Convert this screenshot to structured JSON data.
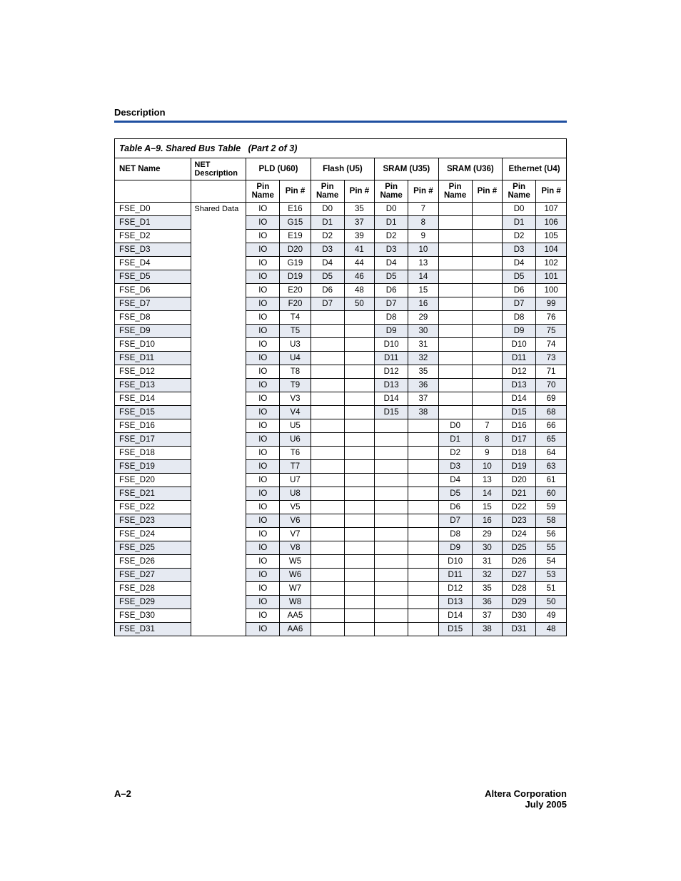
{
  "header": "Description",
  "caption": "Table A–9. Shared Bus Table   (Part 2 of 3)",
  "cols": {
    "net_name": "NET Name",
    "net_desc": "NET Description",
    "groups": [
      "PLD (U60)",
      "Flash (U5)",
      "SRAM (U35)",
      "SRAM (U36)",
      "Ethernet (U4)"
    ],
    "pin_name": "Pin Name",
    "pin_num": "Pin #",
    "pin_num_short": "Pin #"
  },
  "shared_desc": "Shared Data",
  "rows": [
    {
      "n": "FSE_D0",
      "pld": [
        "IO",
        "E16"
      ],
      "flash": [
        "D0",
        "35"
      ],
      "s35": [
        "D0",
        "7"
      ],
      "s36": [
        "",
        ""
      ],
      "eth": [
        "D0",
        "107"
      ]
    },
    {
      "n": "FSE_D1",
      "pld": [
        "IO",
        "G15"
      ],
      "flash": [
        "D1",
        "37"
      ],
      "s35": [
        "D1",
        "8"
      ],
      "s36": [
        "",
        ""
      ],
      "eth": [
        "D1",
        "106"
      ]
    },
    {
      "n": "FSE_D2",
      "pld": [
        "IO",
        "E19"
      ],
      "flash": [
        "D2",
        "39"
      ],
      "s35": [
        "D2",
        "9"
      ],
      "s36": [
        "",
        ""
      ],
      "eth": [
        "D2",
        "105"
      ]
    },
    {
      "n": "FSE_D3",
      "pld": [
        "IO",
        "D20"
      ],
      "flash": [
        "D3",
        "41"
      ],
      "s35": [
        "D3",
        "10"
      ],
      "s36": [
        "",
        ""
      ],
      "eth": [
        "D3",
        "104"
      ]
    },
    {
      "n": "FSE_D4",
      "pld": [
        "IO",
        "G19"
      ],
      "flash": [
        "D4",
        "44"
      ],
      "s35": [
        "D4",
        "13"
      ],
      "s36": [
        "",
        ""
      ],
      "eth": [
        "D4",
        "102"
      ]
    },
    {
      "n": "FSE_D5",
      "pld": [
        "IO",
        "D19"
      ],
      "flash": [
        "D5",
        "46"
      ],
      "s35": [
        "D5",
        "14"
      ],
      "s36": [
        "",
        ""
      ],
      "eth": [
        "D5",
        "101"
      ]
    },
    {
      "n": "FSE_D6",
      "pld": [
        "IO",
        "E20"
      ],
      "flash": [
        "D6",
        "48"
      ],
      "s35": [
        "D6",
        "15"
      ],
      "s36": [
        "",
        ""
      ],
      "eth": [
        "D6",
        "100"
      ]
    },
    {
      "n": "FSE_D7",
      "pld": [
        "IO",
        "F20"
      ],
      "flash": [
        "D7",
        "50"
      ],
      "s35": [
        "D7",
        "16"
      ],
      "s36": [
        "",
        ""
      ],
      "eth": [
        "D7",
        "99"
      ]
    },
    {
      "n": "FSE_D8",
      "pld": [
        "IO",
        "T4"
      ],
      "flash": [
        "",
        ""
      ],
      "s35": [
        "D8",
        "29"
      ],
      "s36": [
        "",
        ""
      ],
      "eth": [
        "D8",
        "76"
      ]
    },
    {
      "n": "FSE_D9",
      "pld": [
        "IO",
        "T5"
      ],
      "flash": [
        "",
        ""
      ],
      "s35": [
        "D9",
        "30"
      ],
      "s36": [
        "",
        ""
      ],
      "eth": [
        "D9",
        "75"
      ]
    },
    {
      "n": "FSE_D10",
      "pld": [
        "IO",
        "U3"
      ],
      "flash": [
        "",
        ""
      ],
      "s35": [
        "D10",
        "31"
      ],
      "s36": [
        "",
        ""
      ],
      "eth": [
        "D10",
        "74"
      ]
    },
    {
      "n": "FSE_D11",
      "pld": [
        "IO",
        "U4"
      ],
      "flash": [
        "",
        ""
      ],
      "s35": [
        "D11",
        "32"
      ],
      "s36": [
        "",
        ""
      ],
      "eth": [
        "D11",
        "73"
      ]
    },
    {
      "n": "FSE_D12",
      "pld": [
        "IO",
        "T8"
      ],
      "flash": [
        "",
        ""
      ],
      "s35": [
        "D12",
        "35"
      ],
      "s36": [
        "",
        ""
      ],
      "eth": [
        "D12",
        "71"
      ]
    },
    {
      "n": "FSE_D13",
      "pld": [
        "IO",
        "T9"
      ],
      "flash": [
        "",
        ""
      ],
      "s35": [
        "D13",
        "36"
      ],
      "s36": [
        "",
        ""
      ],
      "eth": [
        "D13",
        "70"
      ]
    },
    {
      "n": "FSE_D14",
      "pld": [
        "IO",
        "V3"
      ],
      "flash": [
        "",
        ""
      ],
      "s35": [
        "D14",
        "37"
      ],
      "s36": [
        "",
        ""
      ],
      "eth": [
        "D14",
        "69"
      ]
    },
    {
      "n": "FSE_D15",
      "pld": [
        "IO",
        "V4"
      ],
      "flash": [
        "",
        ""
      ],
      "s35": [
        "D15",
        "38"
      ],
      "s36": [
        "",
        ""
      ],
      "eth": [
        "D15",
        "68"
      ]
    },
    {
      "n": "FSE_D16",
      "pld": [
        "IO",
        "U5"
      ],
      "flash": [
        "",
        ""
      ],
      "s35": [
        "",
        ""
      ],
      "s36": [
        "D0",
        "7"
      ],
      "eth": [
        "D16",
        "66"
      ]
    },
    {
      "n": "FSE_D17",
      "pld": [
        "IO",
        "U6"
      ],
      "flash": [
        "",
        ""
      ],
      "s35": [
        "",
        ""
      ],
      "s36": [
        "D1",
        "8"
      ],
      "eth": [
        "D17",
        "65"
      ]
    },
    {
      "n": "FSE_D18",
      "pld": [
        "IO",
        "T6"
      ],
      "flash": [
        "",
        ""
      ],
      "s35": [
        "",
        ""
      ],
      "s36": [
        "D2",
        "9"
      ],
      "eth": [
        "D18",
        "64"
      ]
    },
    {
      "n": "FSE_D19",
      "pld": [
        "IO",
        "T7"
      ],
      "flash": [
        "",
        ""
      ],
      "s35": [
        "",
        ""
      ],
      "s36": [
        "D3",
        "10"
      ],
      "eth": [
        "D19",
        "63"
      ]
    },
    {
      "n": "FSE_D20",
      "pld": [
        "IO",
        "U7"
      ],
      "flash": [
        "",
        ""
      ],
      "s35": [
        "",
        ""
      ],
      "s36": [
        "D4",
        "13"
      ],
      "eth": [
        "D20",
        "61"
      ]
    },
    {
      "n": "FSE_D21",
      "pld": [
        "IO",
        "U8"
      ],
      "flash": [
        "",
        ""
      ],
      "s35": [
        "",
        ""
      ],
      "s36": [
        "D5",
        "14"
      ],
      "eth": [
        "D21",
        "60"
      ]
    },
    {
      "n": "FSE_D22",
      "pld": [
        "IO",
        "V5"
      ],
      "flash": [
        "",
        ""
      ],
      "s35": [
        "",
        ""
      ],
      "s36": [
        "D6",
        "15"
      ],
      "eth": [
        "D22",
        "59"
      ]
    },
    {
      "n": "FSE_D23",
      "pld": [
        "IO",
        "V6"
      ],
      "flash": [
        "",
        ""
      ],
      "s35": [
        "",
        ""
      ],
      "s36": [
        "D7",
        "16"
      ],
      "eth": [
        "D23",
        "58"
      ]
    },
    {
      "n": "FSE_D24",
      "pld": [
        "IO",
        "V7"
      ],
      "flash": [
        "",
        ""
      ],
      "s35": [
        "",
        ""
      ],
      "s36": [
        "D8",
        "29"
      ],
      "eth": [
        "D24",
        "56"
      ]
    },
    {
      "n": "FSE_D25",
      "pld": [
        "IO",
        "V8"
      ],
      "flash": [
        "",
        ""
      ],
      "s35": [
        "",
        ""
      ],
      "s36": [
        "D9",
        "30"
      ],
      "eth": [
        "D25",
        "55"
      ]
    },
    {
      "n": "FSE_D26",
      "pld": [
        "IO",
        "W5"
      ],
      "flash": [
        "",
        ""
      ],
      "s35": [
        "",
        ""
      ],
      "s36": [
        "D10",
        "31"
      ],
      "eth": [
        "D26",
        "54"
      ]
    },
    {
      "n": "FSE_D27",
      "pld": [
        "IO",
        "W6"
      ],
      "flash": [
        "",
        ""
      ],
      "s35": [
        "",
        ""
      ],
      "s36": [
        "D11",
        "32"
      ],
      "eth": [
        "D27",
        "53"
      ]
    },
    {
      "n": "FSE_D28",
      "pld": [
        "IO",
        "W7"
      ],
      "flash": [
        "",
        ""
      ],
      "s35": [
        "",
        ""
      ],
      "s36": [
        "D12",
        "35"
      ],
      "eth": [
        "D28",
        "51"
      ]
    },
    {
      "n": "FSE_D29",
      "pld": [
        "IO",
        "W8"
      ],
      "flash": [
        "",
        ""
      ],
      "s35": [
        "",
        ""
      ],
      "s36": [
        "D13",
        "36"
      ],
      "eth": [
        "D29",
        "50"
      ]
    },
    {
      "n": "FSE_D30",
      "pld": [
        "IO",
        "AA5"
      ],
      "flash": [
        "",
        ""
      ],
      "s35": [
        "",
        ""
      ],
      "s36": [
        "D14",
        "37"
      ],
      "eth": [
        "D30",
        "49"
      ]
    },
    {
      "n": "FSE_D31",
      "pld": [
        "IO",
        "AA6"
      ],
      "flash": [
        "",
        ""
      ],
      "s35": [
        "",
        ""
      ],
      "s36": [
        "D15",
        "38"
      ],
      "eth": [
        "D31",
        "48"
      ]
    }
  ],
  "footer": {
    "left": "A–2",
    "right1": "Altera Corporation",
    "right2": "July 2005"
  }
}
